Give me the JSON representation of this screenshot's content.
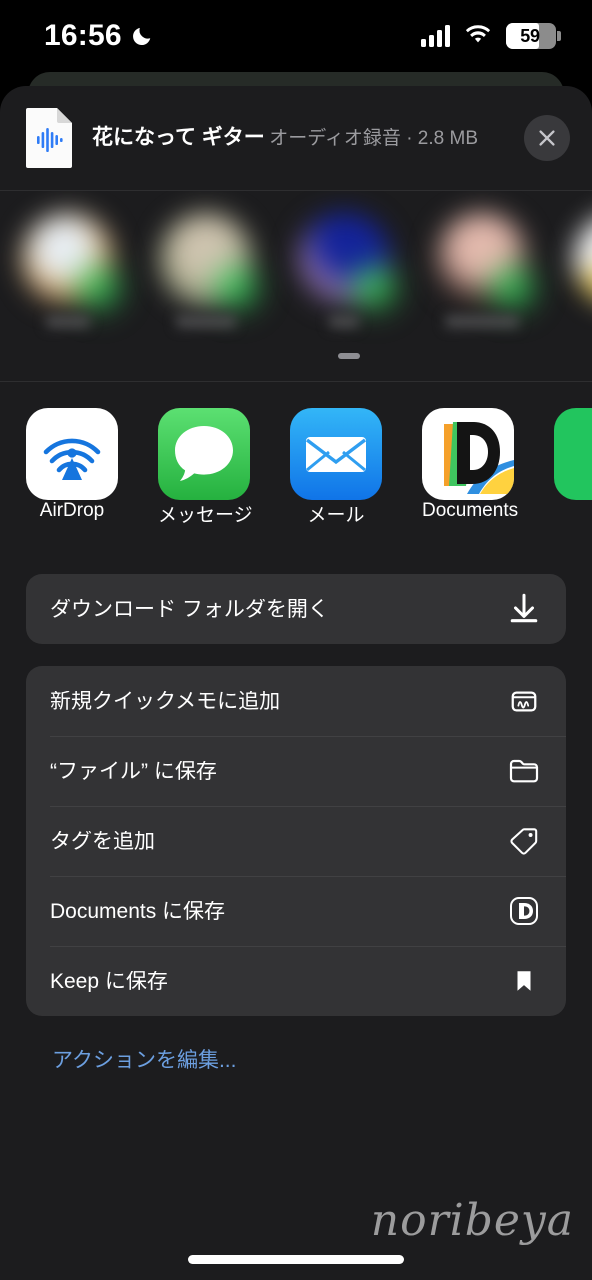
{
  "status_bar": {
    "time": "16:56",
    "moon_icon": "crescent-moon-icon",
    "signal_icon": "cellular-signal-icon",
    "wifi_icon": "wifi-icon",
    "battery_percent": "59"
  },
  "share_sheet": {
    "file": {
      "icon": "audio-document-icon",
      "title": "花になって ギター",
      "subtitle": "オーディオ録音 · 2.8 MB"
    },
    "close_label": "×",
    "contacts": [
      {
        "name_redacted": true
      },
      {
        "name_redacted": true
      },
      {
        "name_redacted": true
      },
      {
        "name_redacted": true
      },
      {
        "name_redacted": true
      }
    ],
    "apps": [
      {
        "label": "AirDrop",
        "icon": "airdrop-icon"
      },
      {
        "label": "メッセージ",
        "icon": "messages-icon"
      },
      {
        "label": "メール",
        "icon": "mail-icon"
      },
      {
        "label": "Documents",
        "icon": "documents-icon"
      },
      {
        "label": "",
        "icon": "green-app-icon"
      }
    ],
    "primary_actions": [
      {
        "label": "ダウンロード フォルダを開く",
        "icon": "download-icon"
      }
    ],
    "actions": [
      {
        "label": "新規クイックメモに追加",
        "icon": "quick-note-icon"
      },
      {
        "label": "“ファイル” に保存",
        "icon": "folder-icon"
      },
      {
        "label": "タグを追加",
        "icon": "tag-icon"
      },
      {
        "label": "Documents に保存",
        "icon": "documents-badge-icon"
      },
      {
        "label": "Keep に保存",
        "icon": "bookmark-icon"
      }
    ],
    "edit_actions_label": "アクションを編集..."
  },
  "watermark": "noribeya",
  "colors": {
    "page_background": "#000000",
    "sheet_background": "#1c1c1e",
    "card_background": "#333335",
    "accent_link": "#6c9fe0",
    "text_primary": "#ffffff",
    "text_secondary": "#9b9b9f",
    "badge_green": "#35c759"
  }
}
